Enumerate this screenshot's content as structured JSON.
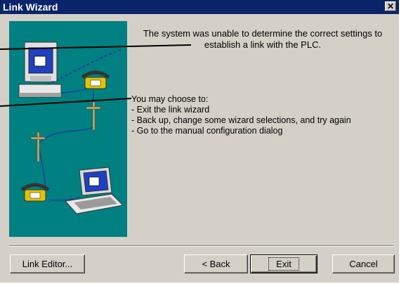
{
  "window": {
    "title": "Link Wizard",
    "close_label": "✕"
  },
  "message": "The system was unable to determine the correct settings to establish a link with the PLC.",
  "choose": {
    "heading": "You may choose to:",
    "items": [
      "-  Exit the link wizard",
      "-  Back up, change some wizard selections, and try again",
      "-  Go to the manual configuration dialog"
    ]
  },
  "buttons": {
    "link_editor": "Link Editor...",
    "back": "< Back",
    "exit": "Exit",
    "cancel": "Cancel"
  },
  "colors": {
    "title_bar": "#0a246a",
    "illustration_bg": "#008080",
    "face": "#d4d0c8"
  }
}
